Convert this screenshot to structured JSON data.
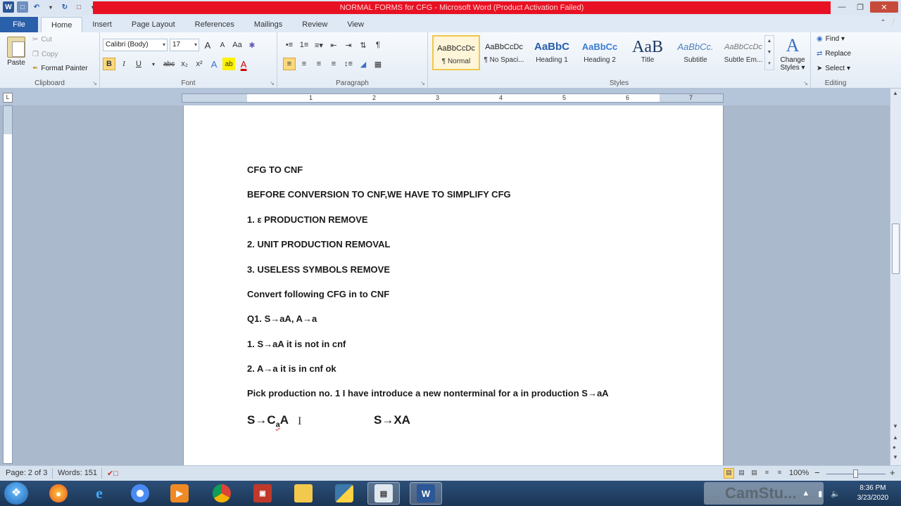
{
  "window": {
    "title": "NORMAL FORMS for CFG  -  Microsoft Word (Product Activation Failed)",
    "word_logo": "W"
  },
  "tabs": {
    "file": "File",
    "items": [
      "Home",
      "Insert",
      "Page Layout",
      "References",
      "Mailings",
      "Review",
      "View"
    ]
  },
  "ribbon": {
    "clipboard": {
      "paste": "Paste",
      "cut": "Cut",
      "copy": "Copy",
      "format_painter": "Format Painter",
      "label": "Clipboard"
    },
    "font": {
      "family": "Calibri (Body)",
      "size": "17",
      "label": "Font",
      "bold": "B",
      "italic": "I",
      "underline": "U",
      "strike": "abc",
      "grow": "A",
      "shrink": "A",
      "case": "Aa",
      "subscript": "x₂",
      "superscript": "x²",
      "effects": "A",
      "highlight": "ab",
      "color": "A"
    },
    "paragraph": {
      "label": "Paragraph",
      "pilcrow": "¶"
    },
    "styles": {
      "label": "Styles",
      "items": [
        {
          "sample": "AaBbCcDc",
          "name": "¶ Normal"
        },
        {
          "sample": "AaBbCcDc",
          "name": "¶ No Spaci..."
        },
        {
          "sample": "AaBbC",
          "name": "Heading 1"
        },
        {
          "sample": "AaBbCc",
          "name": "Heading 2"
        },
        {
          "sample": "AaB",
          "name": "Title"
        },
        {
          "sample": "AaBbCc.",
          "name": "Subtitle"
        },
        {
          "sample": "AaBbCcDc",
          "name": "Subtle Em..."
        }
      ],
      "change_styles_icon": "A",
      "change_styles_line1": "Change",
      "change_styles_line2": "Styles ▾"
    },
    "editing": {
      "label": "Editing",
      "find": "Find ▾",
      "replace": "Replace",
      "select": "Select ▾"
    }
  },
  "ruler": {
    "numbers": [
      "1",
      "2",
      "3",
      "4",
      "5",
      "6",
      "7"
    ]
  },
  "document": {
    "lines": [
      "CFG TO CNF",
      "BEFORE CONVERSION TO CNF,WE HAVE TO SIMPLIFY CFG",
      "1. ε PRODUCTION REMOVE",
      "2. UNIT PRODUCTION REMOVAL",
      "3. USELESS SYMBOLS REMOVE",
      "Convert following CFG in to CNF",
      "Q1. S→aA,  A→a",
      "1. S→aA   it is not in cnf",
      "2. A→a  it is in cnf   ok",
      "Pick production no. 1 I have introduce a new nonterminal for a in production S→aA"
    ],
    "big_line_left_prefix": "S→C",
    "big_line_left_sub": "a",
    "big_line_left_suffix": "A",
    "big_line_right": "S→XA",
    "cursor": "I"
  },
  "status": {
    "page": "Page: 2 of 3",
    "words": "Words: 151",
    "zoom": "100%",
    "zoom_out": "−",
    "zoom_in": "+"
  },
  "taskbar": {
    "time": "8:36 PM",
    "date": "3/23/2020",
    "watermark": "CamStu..."
  },
  "colors": {
    "title_bar_red": "#e81123",
    "file_tab": "#2a5faa",
    "squiggle_green": "#3aa33a",
    "squiggle_red": "#d22222"
  }
}
